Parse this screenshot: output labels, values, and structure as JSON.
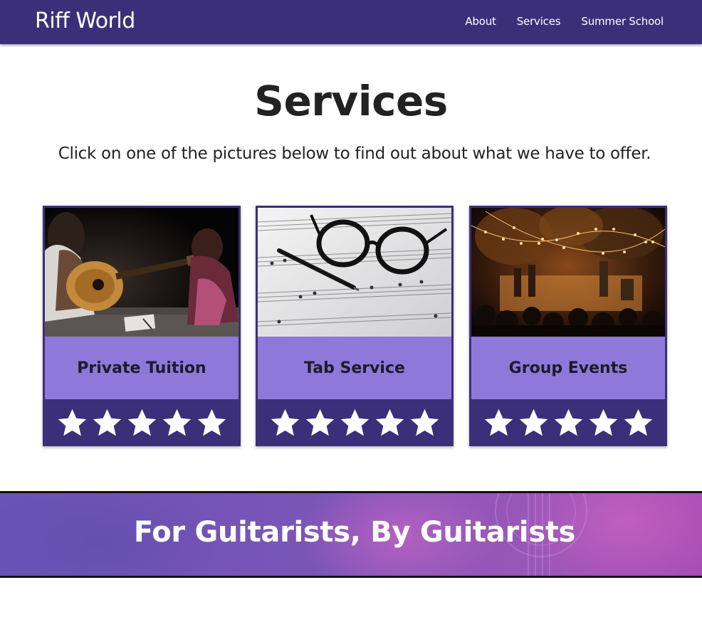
{
  "brand": "Riff World",
  "nav": [
    "About",
    "Services",
    "Summer School"
  ],
  "page": {
    "title": "Services",
    "intro": "Click on one of the pictures below to find out about what we have to offer."
  },
  "cards": [
    {
      "label": "Private Tuition",
      "rating": 5,
      "image": "guitar-lesson-photo"
    },
    {
      "label": "Tab Service",
      "rating": 5,
      "image": "glasses-on-sheet-music-photo"
    },
    {
      "label": "Group Events",
      "rating": 5,
      "image": "outdoor-concert-photo"
    }
  ],
  "banner": {
    "title": "For Guitarists, By Guitarists"
  },
  "colors": {
    "nav_bg": "#3c2f7a",
    "card_label_bg": "#8e78da",
    "banner_start": "#6a53b4",
    "banner_end": "#a74db3"
  }
}
